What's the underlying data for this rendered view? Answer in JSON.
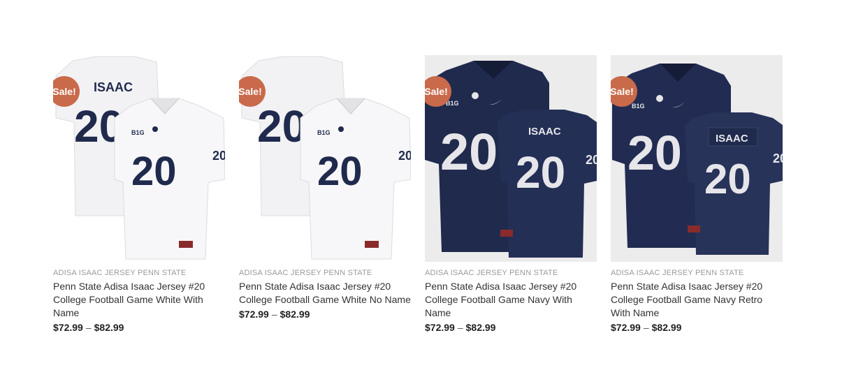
{
  "colors": {
    "accent": "#c96a4a",
    "navy": "#1f2a4d",
    "white_jersey": "#f4f4f6"
  },
  "products": [
    {
      "badge": "Sale!",
      "category": "ADISA ISAAC JERSEY PENN STATE",
      "title": "Penn State Adisa Isaac Jersey #20 College Football Game White With Name",
      "price_min": "$72.99",
      "price_sep": "–",
      "price_max": "$82.99",
      "jersey_number": "20",
      "back_name": "ISAAC",
      "front_label": "B1G",
      "variant": "white"
    },
    {
      "badge": "Sale!",
      "category": "ADISA ISAAC JERSEY PENN STATE",
      "title": "Penn State Adisa Isaac Jersey #20 College Football Game White No Name",
      "price_min": "$72.99",
      "price_sep": "–",
      "price_max": "$82.99",
      "jersey_number": "20",
      "back_name": "",
      "front_label": "B1G",
      "variant": "white"
    },
    {
      "badge": "Sale!",
      "category": "ADISA ISAAC JERSEY PENN STATE",
      "title": "Penn State Adisa Isaac Jersey #20 College Football Game Navy With Name",
      "price_min": "$72.99",
      "price_sep": "–",
      "price_max": "$82.99",
      "jersey_number": "20",
      "back_name": "ISAAC",
      "front_label": "B1G",
      "variant": "navy"
    },
    {
      "badge": "Sale!",
      "category": "ADISA ISAAC JERSEY PENN STATE",
      "title": "Penn State Adisa Isaac Jersey #20 College Football Game Navy Retro With Name",
      "price_min": "$72.99",
      "price_sep": "–",
      "price_max": "$82.99",
      "jersey_number": "20",
      "back_name": "ISAAC",
      "front_label": "B1G",
      "variant": "navy"
    }
  ]
}
